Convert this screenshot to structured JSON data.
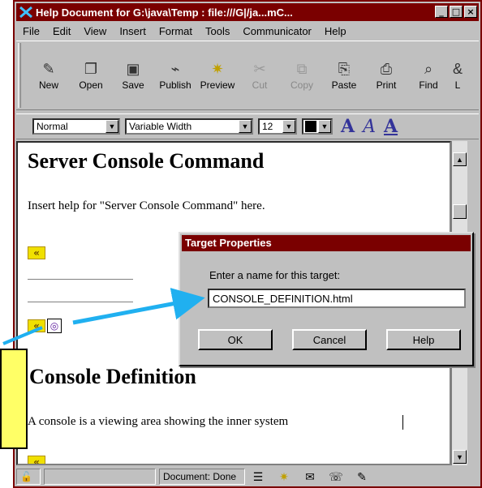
{
  "window": {
    "title": "Help Document for G:\\java\\Temp : file:///G|/ja...mC...",
    "controls": [
      "_",
      "□",
      "×"
    ]
  },
  "menu": [
    "File",
    "Edit",
    "View",
    "Insert",
    "Format",
    "Tools",
    "Communicator",
    "Help"
  ],
  "toolbar": [
    {
      "label": "New",
      "icon": "new-page-icon"
    },
    {
      "label": "Open",
      "icon": "open-icon"
    },
    {
      "label": "Save",
      "icon": "save-icon"
    },
    {
      "label": "Publish",
      "icon": "publish-icon"
    },
    {
      "label": "Preview",
      "icon": "preview-icon"
    },
    {
      "label": "Cut",
      "icon": "cut-icon",
      "disabled": true
    },
    {
      "label": "Copy",
      "icon": "copy-icon",
      "disabled": true
    },
    {
      "label": "Paste",
      "icon": "paste-icon"
    },
    {
      "label": "Print",
      "icon": "print-icon"
    },
    {
      "label": "Find",
      "icon": "find-icon"
    },
    {
      "label": "L",
      "icon": "link-icon"
    }
  ],
  "format": {
    "style": "Normal",
    "font": "Variable Width",
    "size": "12",
    "text_color": "#000000",
    "a_glyph": "A"
  },
  "document": {
    "heading1": "Server Console Command",
    "para1": "Insert help for \"Server Console Command\" here.",
    "heading2": "Console Definition",
    "para2": "A console is a viewing area showing the inner system"
  },
  "status": {
    "text": "Document: Done"
  },
  "dialog": {
    "title": "Target Properties",
    "prompt": "Enter a name for this target:",
    "value": "CONSOLE_DEFINITION.html",
    "ok": "OK",
    "cancel": "Cancel",
    "help": "Help"
  },
  "colors": {
    "titlebar": "#7a0000",
    "callout": "#ffff66",
    "arrow": "#20b0f0"
  }
}
